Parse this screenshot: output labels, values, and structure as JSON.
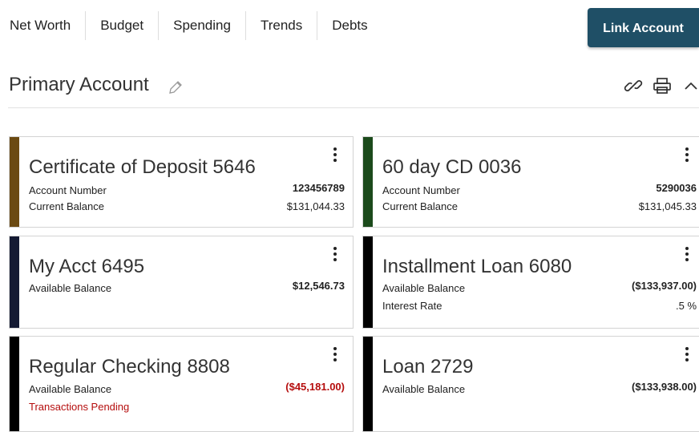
{
  "nav": {
    "tabs": [
      "Net Worth",
      "Budget",
      "Spending",
      "Trends",
      "Debts"
    ],
    "link_account_label": "Link Account"
  },
  "section": {
    "title": "Primary Account"
  },
  "icons": {
    "edit": "pencil-icon",
    "link": "link-icon",
    "print": "printer-icon",
    "collapse": "chevron-up-icon",
    "menu": "kebab-menu-icon"
  },
  "colors": {
    "brand_button": "#1f4f66",
    "negative_text": "#b50d0d"
  },
  "cards": [
    {
      "name": "Certificate of Deposit 5646",
      "stripe_color": "#6b4a12",
      "rows": [
        {
          "label": "Account Number",
          "value": "123456789"
        },
        {
          "label": "Current Balance",
          "value": "$131,044.33"
        }
      ]
    },
    {
      "name": "60 day CD 0036",
      "stripe_color": "#1b4a1b",
      "rows": [
        {
          "label": "Account Number",
          "value": "5290036"
        },
        {
          "label": "Current Balance",
          "value": "$131,045.33"
        }
      ]
    },
    {
      "name": "My Acct 6495",
      "stripe_color": "#141a33",
      "rows": [
        {
          "label": "Available Balance",
          "value": "$12,546.73"
        }
      ]
    },
    {
      "name": "Installment Loan 6080",
      "stripe_color": "#000000",
      "rows": [
        {
          "label": "Available Balance",
          "value": "($133,937.00)"
        },
        {
          "label": "Interest Rate",
          "value": ".5 %"
        }
      ]
    },
    {
      "name": "Regular Checking 8808",
      "stripe_color": "#000000",
      "rows": [
        {
          "label": "Available Balance",
          "value": "($45,181.00)"
        },
        {
          "label": "Transactions Pending",
          "value": ""
        }
      ]
    },
    {
      "name": "Loan 2729",
      "stripe_color": "#000000",
      "rows": [
        {
          "label": "Available Balance",
          "value": "($133,938.00)"
        }
      ]
    }
  ]
}
